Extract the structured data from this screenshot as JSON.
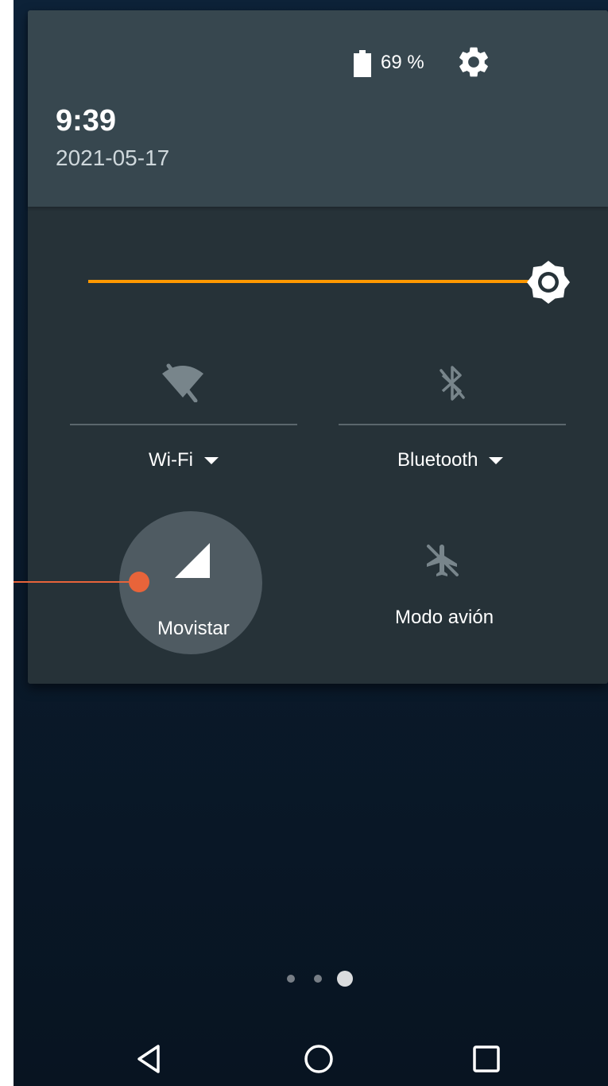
{
  "status": {
    "battery_percent": "69 %",
    "time": "9:39",
    "date": "2021-05-17"
  },
  "brightness": {
    "level": 1.0
  },
  "tiles": {
    "wifi": {
      "label": "Wi-Fi",
      "icon": "wifi-off-icon"
    },
    "bluetooth": {
      "label": "Bluetooth",
      "icon": "bluetooth-off-icon"
    },
    "cellular": {
      "label": "Movistar",
      "icon": "signal-icon"
    },
    "airplane": {
      "label": "Modo avión",
      "icon": "airplane-icon"
    }
  },
  "pager": {
    "count": 3,
    "active": 2
  },
  "colors": {
    "accent": "#ff9800",
    "panel": "#263238",
    "header": "#37474f",
    "annotation": "#e8643a"
  }
}
